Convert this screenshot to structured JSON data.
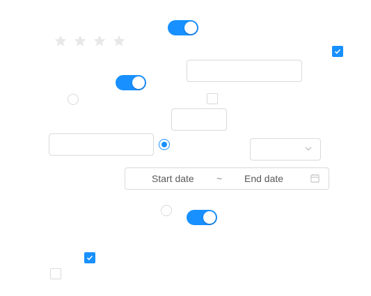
{
  "colors": {
    "accent": "#1890ff",
    "border": "#d9d9d9",
    "star_empty": "#e8e8e8"
  },
  "rating": {
    "value": 0,
    "max": 4
  },
  "toggles": [
    {
      "state": "on"
    },
    {
      "state": "on"
    },
    {
      "state": "on"
    }
  ],
  "checkboxes": [
    {
      "checked": true
    },
    {
      "checked": false
    },
    {
      "checked": true
    },
    {
      "checked": false
    }
  ],
  "radios": [
    {
      "checked": false
    },
    {
      "checked": true
    },
    {
      "checked": false
    }
  ],
  "date_range": {
    "start_placeholder": "Start date",
    "separator": "~",
    "end_placeholder": "End date",
    "icon": "calendar-icon"
  },
  "select": {
    "value": "",
    "icon": "chevron-down-icon"
  }
}
